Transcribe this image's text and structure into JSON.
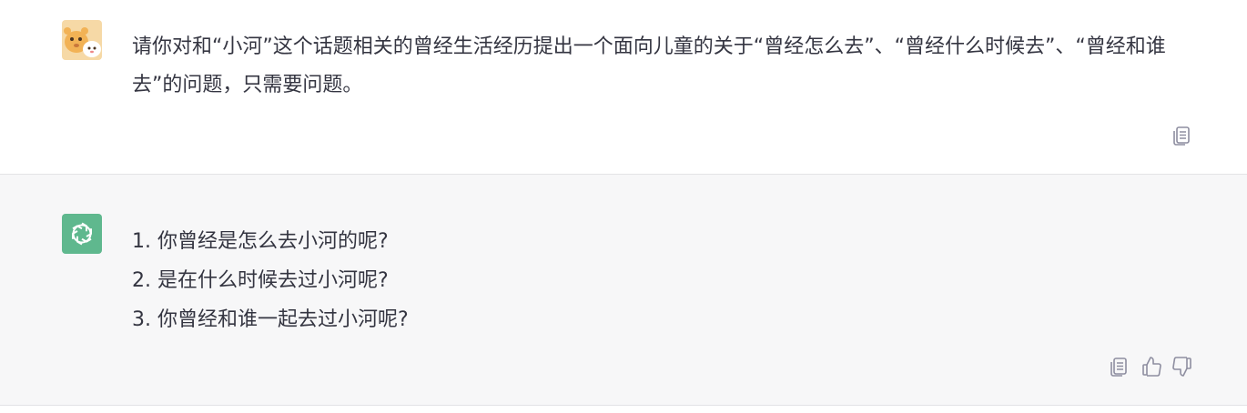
{
  "user_message": {
    "text": "请你对和“小河”这个话题相关的曾经生活经历提出一个面向儿童的关于“曾经怎么去”、“曾经什么时候去”、“曾经和谁去”的问题，只需要问题。"
  },
  "assistant_message": {
    "lines": [
      "1. 你曾经是怎么去小河的呢?",
      "2. 是在什么时候去过小河呢?",
      "3. 你曾经和谁一起去过小河呢?"
    ]
  },
  "icons": {
    "user_avatar": "user-avatar-icon",
    "assistant_avatar": "openai-logo-icon",
    "copy": "copy-icon",
    "thumbs_up": "thumbs-up-icon",
    "thumbs_down": "thumbs-down-icon"
  },
  "colors": {
    "assistant_avatar_bg": "#5fb88e",
    "assistant_row_bg": "#f7f7f8",
    "text": "#343541",
    "icon_gray": "#8e8ea0"
  }
}
